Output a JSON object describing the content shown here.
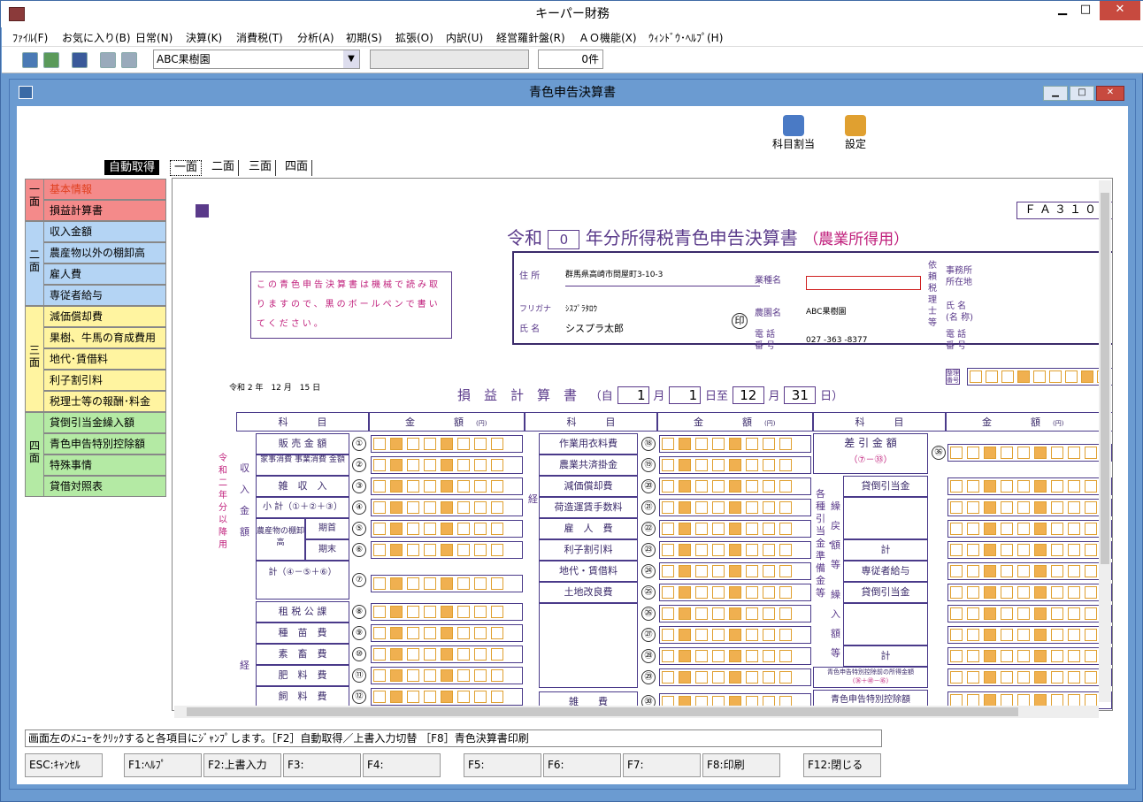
{
  "window": {
    "title": "キーパー財務",
    "min": "▁",
    "max": "□",
    "close": "✕"
  },
  "menu": [
    "ﾌｧｲﾙ(F)",
    "お気に入り(B)",
    "日常(N)",
    "決算(K)",
    "消費税(T)",
    "分析(A)",
    "初期(S)",
    "拡張(O)",
    "内訳(U)",
    "経営羅針盤(R)",
    "ＡＯ機能(X)",
    "ｳｨﾝﾄﾞｳ･ﾍﾙﾌﾟ(H)"
  ],
  "toolbar": {
    "company": "ABC果樹園",
    "count": "0件"
  },
  "mdi": {
    "title": "青色申告決算書"
  },
  "actions": {
    "assign": "科目割当",
    "settings": "設定"
  },
  "tabs": {
    "auto": "自動取得",
    "t1": "一面",
    "t2": "二面",
    "t3": "三面",
    "t4": "四面"
  },
  "nav": {
    "g1": "一\n面",
    "g2": "二\n面",
    "g3": "三\n面",
    "g4": "四\n面",
    "items": [
      "基本情報",
      "損益計算書",
      "収入金額",
      "農産物以外の棚卸高",
      "雇人費",
      "専従者給与",
      "減価償却費",
      "果樹、牛馬の育成費用",
      "地代･賃借料",
      "利子割引料",
      "税理士等の報酬･料金",
      "貸倒引当金繰入額",
      "青色申告特別控除額",
      "特殊事情",
      "貸借対照表"
    ]
  },
  "form": {
    "code": "ＦＡ３１０",
    "title_pre": "令和",
    "year": "0",
    "title_main": "年分所得税青色申告決算書",
    "title_sub": "（農業所得用）",
    "notice": "この青色申告決算書は機械で読み取りますので、黒のボールペンで書いてください。",
    "addr_label": "住 所",
    "addr": "群馬県高崎市問屋町3-10-3",
    "furi_label": "フリガナ",
    "furi": "ｼｽﾌﾟﾗﾀﾛｳ",
    "name_label": "氏 名",
    "name": "シスプラ太郎",
    "seal": "印",
    "biz_label": "業種名",
    "farm_label": "農園名",
    "farm": "ABC果樹園",
    "tel_label": "電 話\n番 号",
    "tel": "027 -363 -8377",
    "tax_label": "依頼税理士等",
    "office_label": "事務所\n所在地",
    "tname_label": "氏 名\n(名 称)",
    "ttel_label": "電 話\n番 号",
    "admin_label": "整理\n番号",
    "date": "令和 2 年　12 月　15 日",
    "pl_title": "損　益　計　算　書",
    "pl_from": "（自",
    "m1": "1",
    "d1": "1",
    "to": "至",
    "m2": "12",
    "d2": "31",
    "month": "月",
    "day": "日",
    "pl_end": "日）",
    "side_note": "令和二年分以降用",
    "h_item": "科　　　目",
    "h_amount": "金　　　　額",
    "h_yen": "(円)",
    "income_vlabel": "収入金額",
    "exp_vlabel": "経",
    "rows1": [
      {
        "label": "販 売 金 額",
        "no": "①"
      },
      {
        "label": "家事消費 事業消費 金額",
        "no": "②"
      },
      {
        "label": "雑　収　入",
        "no": "③"
      },
      {
        "label": "小 計（①＋②＋③）",
        "no": "④"
      },
      {
        "label": "期首",
        "no": "⑤"
      },
      {
        "label": "期末",
        "no": "⑥"
      },
      {
        "label": "計（④－⑤＋⑥）",
        "no": "⑦"
      },
      {
        "label": "租 税 公 課",
        "no": "⑧"
      },
      {
        "label": "種　苗　費",
        "no": "⑨"
      },
      {
        "label": "素　畜　費",
        "no": "⑩"
      },
      {
        "label": "肥　料　費",
        "no": "⑪"
      },
      {
        "label": "飼　料　費",
        "no": "⑫"
      }
    ],
    "tana": "農産物の棚卸高",
    "rows2": [
      {
        "label": "作業用衣料費",
        "no": "⑱"
      },
      {
        "label": "農業共済掛金",
        "no": "⑲"
      },
      {
        "label": "減価償却費",
        "no": "⑳"
      },
      {
        "label": "荷造運賃手数料",
        "no": "㉑"
      },
      {
        "label": "雇　人　費",
        "no": "㉒"
      },
      {
        "label": "利子割引料",
        "no": "㉓"
      },
      {
        "label": "地代・賃借料",
        "no": "㉔"
      },
      {
        "label": "土地改良費",
        "no": "㉕"
      },
      {
        "label": "",
        "no": "㉖"
      },
      {
        "label": "",
        "no": "㉗"
      },
      {
        "label": "",
        "no": "㉘"
      },
      {
        "label": "",
        "no": "㉙"
      },
      {
        "label": "雑　　費",
        "no": "㉚"
      }
    ],
    "rows3": {
      "diff": "差 引 金 額",
      "diff_sub": "（⑦－㉝）",
      "no36": "㊱",
      "vlabel": "各種引当金・準備金等",
      "back": "繰戻額等",
      "fwd": "繰入額等",
      "r37": "貸倒引当金",
      "r41": "専従者給与",
      "r42": "貸倒引当金",
      "total": "計",
      "aoiro": "青色申告特別控除前の所得金額",
      "aoiro_sub": "（㊱＋㊵－㊺）",
      "aoiro2": "青色申告特別控除額"
    },
    "zero": "0"
  },
  "status": "画面左のﾒﾆｭｰをｸﾘｯｸすると各項目にｼﾞｬﾝﾌﾟします。［F2］自動取得／上書入力切替 ［F8］青色決算書印刷",
  "fkeys": [
    "ESC:ｷｬﾝｾﾙ",
    "F1:ﾍﾙﾌﾟ",
    "F2:上書入力",
    "F3:",
    "F4:",
    "F5:",
    "F6:",
    "F7:",
    "F8:印刷",
    "F12:閉じる"
  ]
}
